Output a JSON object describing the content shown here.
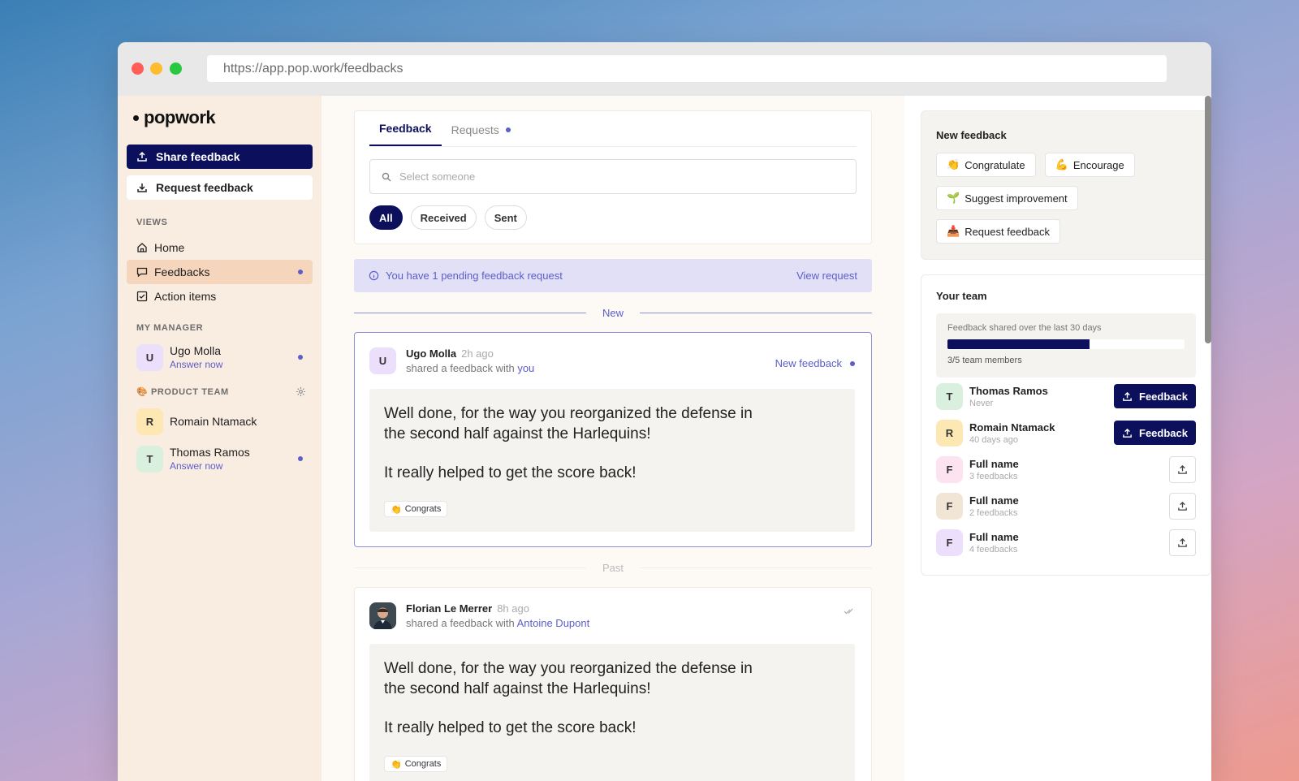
{
  "browser": {
    "url": "https://app.pop.work/feedbacks"
  },
  "sidebar": {
    "logo": "popwork",
    "share_label": "Share feedback",
    "request_label": "Request feedback",
    "views_label": "VIEWS",
    "views": [
      {
        "label": "Home",
        "icon": "home-icon"
      },
      {
        "label": "Feedbacks",
        "icon": "chat-icon",
        "active": true
      },
      {
        "label": "Action items",
        "icon": "checkbox-icon"
      }
    ],
    "manager_label": "MY MANAGER",
    "manager": {
      "initial": "U",
      "name": "Ugo Molla",
      "sub": "Answer now",
      "color": "#ecdffb"
    },
    "team_label": "PRODUCT TEAM",
    "team_emoji": "🎨",
    "team": [
      {
        "initial": "R",
        "name": "Romain Ntamack",
        "sub": "",
        "color": "#fde7b3"
      },
      {
        "initial": "T",
        "name": "Thomas Ramos",
        "sub": "Answer now",
        "color": "#d9f0de"
      }
    ]
  },
  "main": {
    "tabs": [
      {
        "label": "Feedback"
      },
      {
        "label": "Requests"
      }
    ],
    "search_placeholder": "Select someone",
    "filters": [
      "All",
      "Received",
      "Sent"
    ],
    "banner_text": "You have 1 pending feedback request",
    "banner_action": "View request",
    "divider_new": "New",
    "divider_past": "Past",
    "feeds": [
      {
        "initial": "U",
        "author": "Ugo Molla",
        "time": "2h ago",
        "sub_prefix": "shared a feedback with",
        "recipient": "you",
        "badge": "New feedback",
        "text1": "Well done, for the way you reorganized the defense in the second half against the Harlequins!",
        "text2": "It really helped to get the score back!",
        "tag_emoji": "👏",
        "tag": "Congrats"
      },
      {
        "author": "Florian Le Merrer",
        "time": "8h ago",
        "sub_prefix": "shared a feedback with",
        "recipient": "Antoine Dupont",
        "text1": "Well done, for the way you reorganized the defense in the second half against the Harlequins!",
        "text2": "It really helped to get the score back!",
        "tag_emoji": "👏",
        "tag": "Congrats"
      }
    ]
  },
  "right": {
    "new_title": "New feedback",
    "actions": [
      {
        "emoji": "👏",
        "label": "Congratulate"
      },
      {
        "emoji": "💪",
        "label": "Encourage"
      },
      {
        "emoji": "🌱",
        "label": "Suggest improvement"
      },
      {
        "emoji": "📥",
        "label": "Request feedback"
      }
    ],
    "team_title": "Your team",
    "progress_label": "Feedback shared over the last 30 days",
    "progress_count": "3/5 team members",
    "progress_fraction": 0.6,
    "members": [
      {
        "initial": "T",
        "name": "Thomas Ramos",
        "sub": "Never",
        "color": "#d9f0de",
        "button": "Feedback"
      },
      {
        "initial": "R",
        "name": "Romain Ntamack",
        "sub": "40 days ago",
        "color": "#fde7b3",
        "button": "Feedback"
      },
      {
        "initial": "F",
        "name": "Full name",
        "sub": "3 feedbacks",
        "color": "#fde3ef"
      },
      {
        "initial": "F",
        "name": "Full name",
        "sub": "2 feedbacks",
        "color": "#f1e6d6"
      },
      {
        "initial": "F",
        "name": "Full name",
        "sub": "4 feedbacks",
        "color": "#ecdffb"
      }
    ]
  }
}
